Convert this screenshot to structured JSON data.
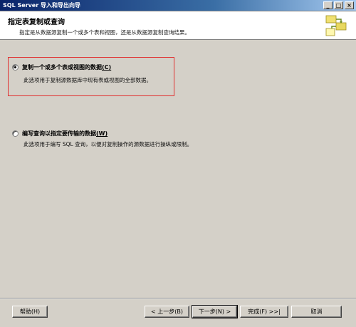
{
  "window": {
    "title": "SQL Server 导入和导出向导",
    "minimize": "_",
    "maximize": "□",
    "close": "×"
  },
  "header": {
    "title": "指定表复制或查询",
    "description": "指定是从数据源复制一个或多个表和视图，还是从数据源复制查询结果。"
  },
  "options": [
    {
      "label": "复制一个或多个表或视图的数据",
      "accel": "(C)",
      "description": "此选项用于复制源数据库中现有表或视图的全部数据。",
      "selected": true
    },
    {
      "label": "编写查询以指定要传输的数据",
      "accel": "(W)",
      "description": "此选项用于编写 SQL 查询，以便对复制操作的源数据进行操纵或限制。",
      "selected": false
    }
  ],
  "buttons": {
    "help": "帮助(H)",
    "back": "< 上一步(B)",
    "next": "下一步(N) >",
    "finish": "完成(F) >>|",
    "cancel": "取消"
  },
  "colors": {
    "highlight_border": "#e03030",
    "title_bar": "#0a246a"
  }
}
